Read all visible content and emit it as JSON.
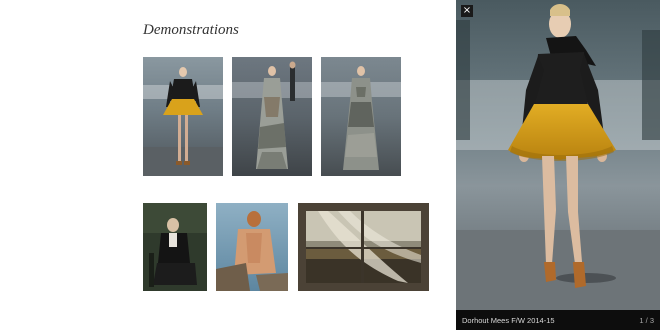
{
  "gallery": {
    "title": "Demonstrations",
    "thumbnails": [
      {
        "subject": "model in black top and mustard skirt on runway"
      },
      {
        "subject": "model in printed gown on runway"
      },
      {
        "subject": "model in printed gown on runway"
      },
      {
        "subject": "seated figure in dark coat painting"
      },
      {
        "subject": "man with bare back by water painting"
      },
      {
        "subject": "window with sheer curtain painting"
      }
    ]
  },
  "lightbox": {
    "caption": "Dorhout Mees F/W 2014-15",
    "counter": "1 / 3",
    "close_icon": "×"
  },
  "colors": {
    "page_background": "#ffffff",
    "lightbox_background": "#111111",
    "skirt_accent": "#d9a21b"
  }
}
